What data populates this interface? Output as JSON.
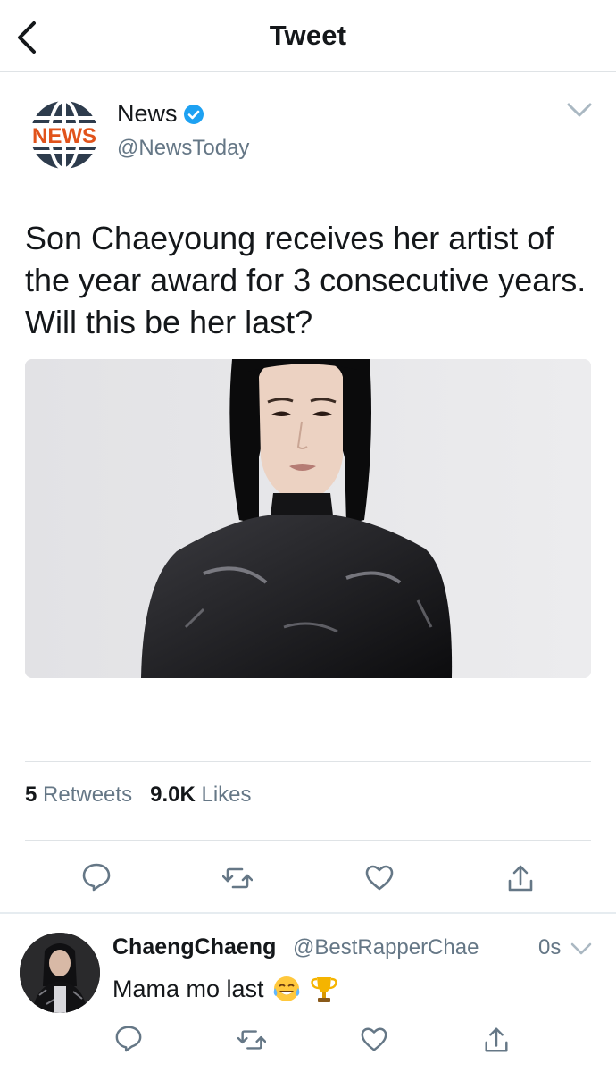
{
  "header": {
    "title": "Tweet"
  },
  "tweet": {
    "author_name": "News",
    "author_handle": "@NewsToday",
    "logo_text": "NEWS",
    "text": "Son Chaeyoung receives her artist of the year award for 3 consecutive years. Will this be her last?",
    "media_icon": "photo-of-person-in-black-latex-top",
    "retweets_count": "5",
    "retweets_label": "Retweets",
    "likes_count": "9.0K",
    "likes_label": "Likes"
  },
  "actions": [
    "reply-icon",
    "retweet-icon",
    "like-icon",
    "share-icon"
  ],
  "reply": {
    "name": "ChaengChaeng",
    "handle": "@BestRapperChae",
    "time": "0s",
    "text": "Mama mo last",
    "emojis": [
      "tears-of-joy-emoji",
      "trophy-emoji"
    ]
  },
  "colors": {
    "accent": "#1da1f2",
    "icon_gray": "#657786",
    "logo_dark": "#2e3c4d",
    "logo_orange": "#e1531b"
  }
}
